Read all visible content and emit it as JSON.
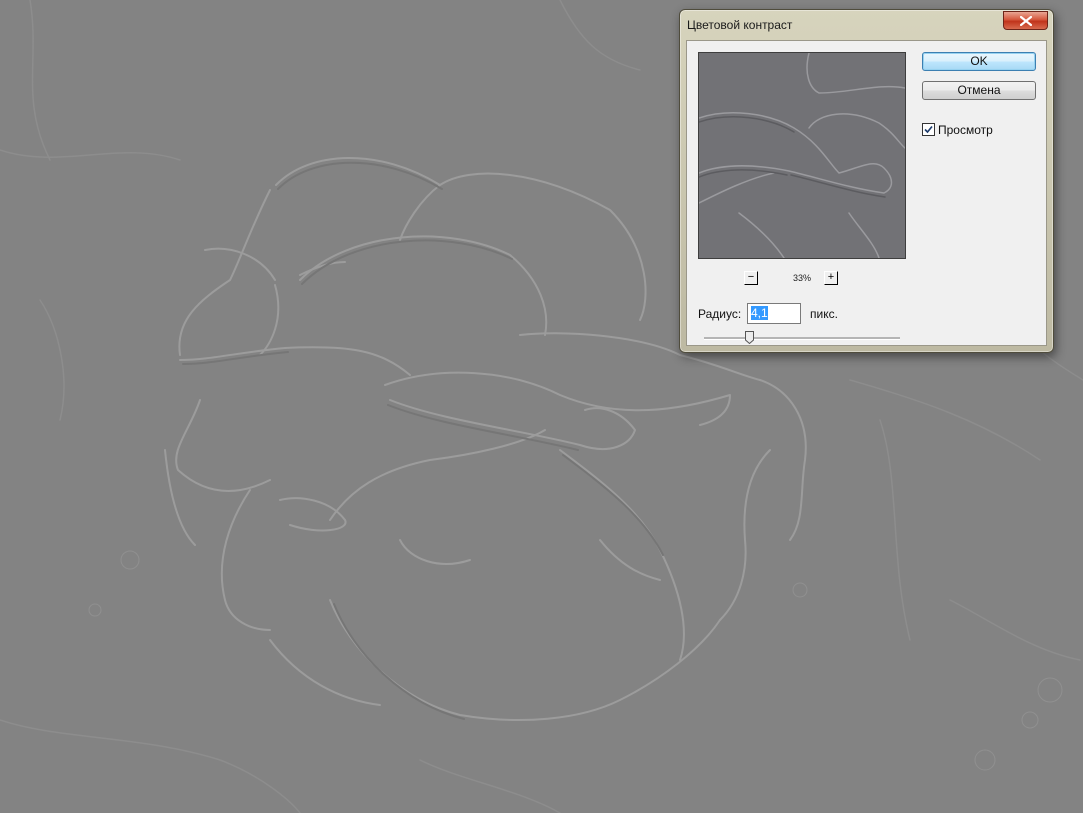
{
  "dialog": {
    "title": "Цветовой контраст",
    "ok_label": "OK",
    "cancel_label": "Отмена",
    "preview_label": "Просмотр",
    "preview_checked": true,
    "zoom_out_label": "−",
    "zoom_in_label": "+",
    "zoom_level": "33%",
    "radius_label": "Радиус:",
    "radius_value": "4,1",
    "radius_unit": "пикс.",
    "radius_slider_fraction": 0.22
  },
  "colors": {
    "canvas_gray": "#838383",
    "ok_accent": "#3c7fb1",
    "selection": "#3399ff",
    "close_red": "#c0341b"
  },
  "icons": {
    "close": "close-x-icon",
    "checkbox": "checkmark-icon",
    "slider": "slider-thumb-icon"
  }
}
